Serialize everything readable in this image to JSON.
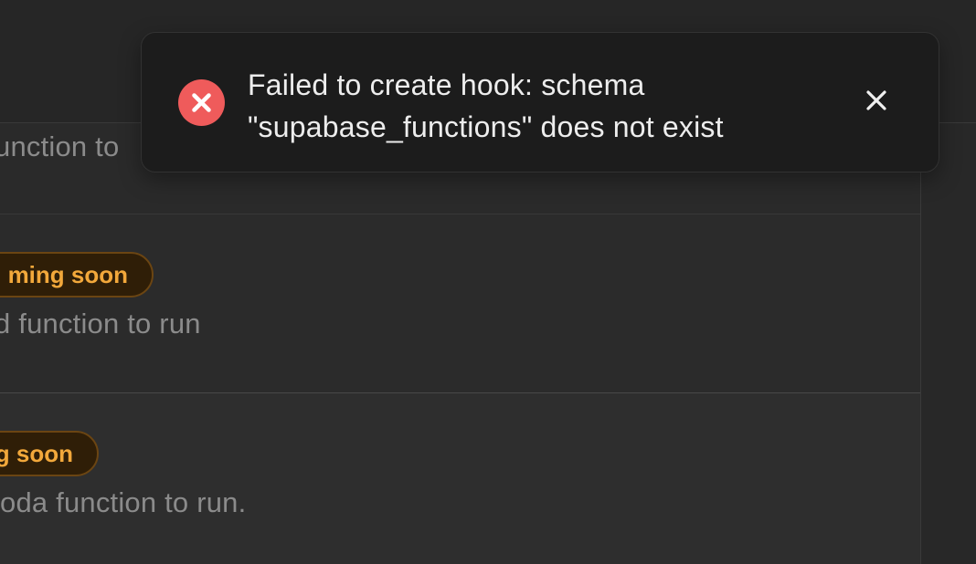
{
  "toast": {
    "line1": "Failed to create hook: schema",
    "line2": "\"supabase_functions\" does not exist",
    "icon": "error-icon",
    "close_icon": "close-icon",
    "status_color": "#ef5b5b"
  },
  "cards": [
    {
      "description": "unction to"
    },
    {
      "badge": "ming soon",
      "description": "d function to run"
    },
    {
      "badge": "g soon",
      "description": "oda function to run."
    }
  ],
  "colors": {
    "background": "#262626",
    "badge_text": "#f2a83b",
    "badge_bg": "#2f1e07"
  }
}
